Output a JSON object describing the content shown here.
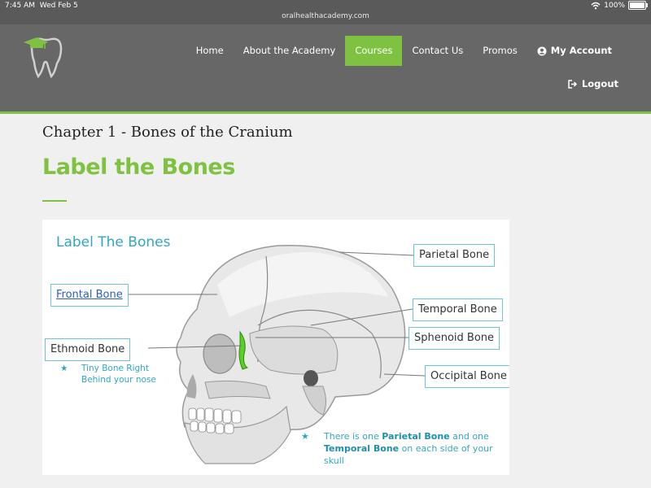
{
  "status": {
    "time": "7:45 AM",
    "date": "Wed Feb 5",
    "url": "oralhealthacademy.com",
    "battery": "100%"
  },
  "nav": {
    "items": [
      {
        "label": "Home"
      },
      {
        "label": "About the Academy"
      },
      {
        "label": "Courses",
        "active": true
      },
      {
        "label": "Contact Us"
      },
      {
        "label": "Promos"
      }
    ],
    "account": "My Account",
    "logout": "Logout"
  },
  "page": {
    "chapter": "Chapter 1 - Bones of the Cranium",
    "title": "Label the Bones"
  },
  "diagram": {
    "title": "Label The Bones",
    "labels": {
      "parietal": "Parietal Bone",
      "frontal": "Frontal Bone",
      "temporal": "Temporal Bone",
      "sphenoid": "Sphenoid Bone",
      "ethmoid": "Ethmoid Bone",
      "occipital": "Occipital Bone"
    },
    "note1_line1": "Tiny Bone Right",
    "note1_line2": "Behind your nose",
    "note2_a": "There is one ",
    "note2_b": "Parietal Bone",
    "note2_c": " and one",
    "note2_d": "Temporal Bone",
    "note2_e": " on each side of your",
    "note2_f": "skull"
  },
  "colors": {
    "accent": "#7fc241",
    "header": "#676767",
    "teal": "#32a6bf"
  }
}
